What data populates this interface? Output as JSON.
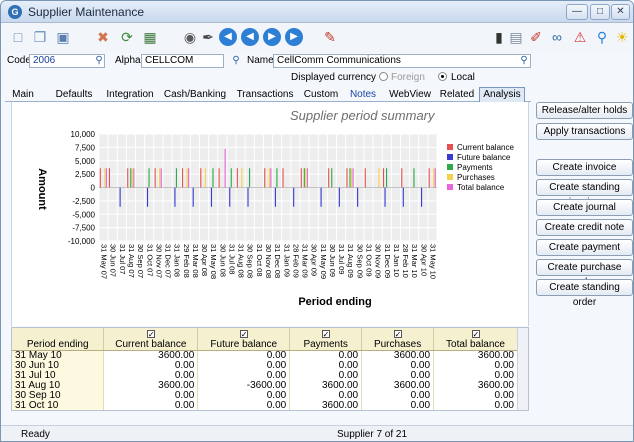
{
  "window": {
    "title": "Supplier Maintenance",
    "app_icon": "G"
  },
  "toolbar_icons": [
    "new-document-icon",
    "copy-icon",
    "save-icon",
    "delete-icon",
    "refresh-icon",
    "grid-icon",
    "find-icon",
    "tools-icon",
    "first-record-icon",
    "previous-record-icon",
    "next-record-icon",
    "last-record-icon",
    "edit-icon",
    "battery-icon",
    "notes-icon",
    "attachment-icon",
    "links-icon",
    "alert-icon",
    "search-icon",
    "tip-icon"
  ],
  "fields": {
    "code_label": "Code",
    "code_value": "2006",
    "alpha_label": "Alpha",
    "alpha_value": "CELLCOM",
    "name_label": "Name",
    "name_value": "CellComm Communications"
  },
  "currency": {
    "label": "Displayed currency",
    "foreign": "Foreign",
    "local": "Local",
    "selected": "Local"
  },
  "tabs": [
    "Main",
    "Defaults",
    "Integration",
    "Cash/Banking",
    "Transactions",
    "Custom",
    "Notes",
    "WebView",
    "Related",
    "Analysis"
  ],
  "active_tab": "Analysis",
  "side_buttons": [
    "Release/alter holds",
    "Apply transactions",
    "Create invoice",
    "Create standing invoice",
    "Create journal",
    "Create credit note",
    "Create payment",
    "Create purchase order",
    "Create standing order"
  ],
  "colors": {
    "current_balance": "#e85050",
    "future_balance": "#3a3ad0",
    "payments": "#2ea84a",
    "purchases": "#f4d24a",
    "total_balance": "#e866d8"
  },
  "chart_data": {
    "type": "bar",
    "title": "Supplier period summary",
    "xlabel": "Period ending",
    "ylabel": "Amount",
    "ylim": [
      -10000,
      10000
    ],
    "yticks": [
      "10,000",
      "7,500",
      "5,000",
      "2,500",
      "0",
      "-2,500",
      "-5,000",
      "-7,500",
      "-10,000"
    ],
    "ytick_values": [
      10000,
      7500,
      5000,
      2500,
      0,
      -2500,
      -5000,
      -7500,
      -10000
    ],
    "grid": true,
    "legend": "right",
    "categories": [
      "31 May 07",
      "30 Jun 07",
      "31 Jul 07",
      "31 Aug 07",
      "30 Sep 07",
      "31 Oct 07",
      "30 Nov 07",
      "31 Dec 07",
      "31 Jan 08",
      "29 Feb 08",
      "31 Mar 08",
      "30 Apr 08",
      "31 May 08",
      "30 Jun 08",
      "31 Jul 08",
      "31 Aug 08",
      "30 Sep 08",
      "31 Oct 08",
      "30 Nov 08",
      "31 Dec 08",
      "31 Jan 09",
      "28 Feb 09",
      "31 Mar 09",
      "30 Apr 09",
      "31 May 09",
      "30 Jun 09",
      "31 Jul 09",
      "31 Aug 09",
      "30 Sep 09",
      "31 Oct 09",
      "30 Nov 09",
      "31 Dec 09",
      "31 Jan 10",
      "28 Feb 10",
      "31 Mar 10",
      "30 Apr 10",
      "31 May 10"
    ],
    "xtick_labels": [
      "31 May 07",
      "30 Jun 07",
      "31 Jul 07",
      "31 Aug 07",
      "30 Sep 07",
      "31 Oct 07",
      "30 Nov 07",
      "31 Dec 07",
      "31 Jan 08",
      "29 Feb 08",
      "31 Mar 08",
      "30 Apr 08",
      "31 May 08",
      "30 Jun 08",
      "31 Jul 08",
      "31 Aug 08",
      "30 Sep 08",
      "31 Oct 08",
      "30 Nov 08",
      "31 Dec 08",
      "31 Jan 09",
      "28 Feb 09",
      "31 Mar 09",
      "30 Apr 09",
      "31 May 09",
      "30 Jun 09",
      "31 Jul 09",
      "31 Aug 09",
      "30 Sep 09",
      "31 Oct 09",
      "30 Nov 09",
      "31 Dec 09",
      "31 Jan 10",
      "28 Feb 10",
      "31 Mar 10",
      "30 Apr 10",
      "31 May 10"
    ],
    "series": [
      {
        "name": "Current balance",
        "values": [
          3600,
          3600,
          0,
          3600,
          0,
          0,
          3600,
          0,
          0,
          3600,
          0,
          3600,
          0,
          3600,
          0,
          3600,
          0,
          0,
          3600,
          0,
          3600,
          0,
          3600,
          0,
          0,
          3600,
          0,
          3600,
          0,
          3600,
          0,
          3600,
          0,
          3600,
          0,
          0,
          3600
        ]
      },
      {
        "name": "Future balance",
        "values": [
          0,
          0,
          -3600,
          0,
          0,
          -3600,
          0,
          0,
          -3600,
          0,
          -3600,
          0,
          -3600,
          0,
          -3600,
          0,
          -3600,
          0,
          0,
          -3600,
          0,
          -3600,
          0,
          0,
          -3600,
          0,
          -3600,
          0,
          -3600,
          0,
          0,
          -3600,
          0,
          -3600,
          0,
          -3600,
          0
        ]
      },
      {
        "name": "Payments",
        "values": [
          0,
          0,
          0,
          3600,
          0,
          3600,
          0,
          0,
          3600,
          0,
          0,
          0,
          3600,
          0,
          3600,
          0,
          3600,
          0,
          0,
          3600,
          0,
          0,
          3600,
          0,
          0,
          3600,
          0,
          3600,
          0,
          0,
          0,
          3600,
          0,
          0,
          3600,
          0,
          0
        ]
      },
      {
        "name": "Purchases",
        "values": [
          3600,
          0,
          0,
          3600,
          0,
          0,
          3600,
          0,
          0,
          3600,
          0,
          3600,
          0,
          0,
          0,
          3600,
          0,
          0,
          3600,
          0,
          0,
          0,
          3600,
          0,
          0,
          0,
          0,
          3600,
          0,
          0,
          3600,
          0,
          0,
          0,
          0,
          0,
          3600
        ]
      },
      {
        "name": "Total balance",
        "values": [
          3600,
          0,
          0,
          3600,
          0,
          0,
          3600,
          0,
          0,
          3600,
          0,
          0,
          0,
          7200,
          0,
          0,
          0,
          0,
          3600,
          0,
          0,
          0,
          3600,
          0,
          0,
          0,
          0,
          3600,
          0,
          0,
          0,
          0,
          0,
          0,
          0,
          0,
          3600
        ]
      }
    ]
  },
  "table": {
    "columns": [
      "Period ending",
      "Current balance",
      "Future balance",
      "Payments",
      "Purchases",
      "Total balance"
    ],
    "rows": [
      [
        "31 May 10",
        "3600.00",
        "0.00",
        "0.00",
        "3600.00",
        "3600.00"
      ],
      [
        "30 Jun 10",
        "0.00",
        "0.00",
        "0.00",
        "0.00",
        "0.00"
      ],
      [
        "31 Jul 10",
        "0.00",
        "0.00",
        "0.00",
        "0.00",
        "0.00"
      ],
      [
        "31 Aug 10",
        "3600.00",
        "-3600.00",
        "3600.00",
        "3600.00",
        "3600.00"
      ],
      [
        "30 Sep 10",
        "0.00",
        "0.00",
        "0.00",
        "0.00",
        "0.00"
      ],
      [
        "31 Oct 10",
        "0.00",
        "0.00",
        "3600.00",
        "0.00",
        "0.00"
      ]
    ]
  },
  "status": {
    "left": "Ready",
    "center": "Supplier 7 of 21"
  }
}
